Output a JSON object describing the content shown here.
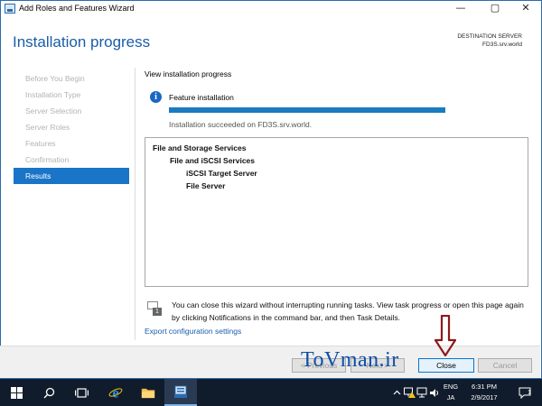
{
  "window": {
    "title": "Add Roles and Features Wizard",
    "controls": {
      "minimize": "—",
      "maximize": "▢",
      "close": "✕"
    }
  },
  "header": {
    "title": "Installation progress",
    "destination_label": "DESTINATION SERVER",
    "destination_server": "FD3S.srv.world"
  },
  "nav": {
    "items": [
      {
        "label": "Before You Begin"
      },
      {
        "label": "Installation Type"
      },
      {
        "label": "Server Selection"
      },
      {
        "label": "Server Roles"
      },
      {
        "label": "Features"
      },
      {
        "label": "Confirmation"
      },
      {
        "label": "Results"
      }
    ],
    "active_index": 6
  },
  "main": {
    "section_label": "View installation progress",
    "feature_label": "Feature installation",
    "progress_fraction": 1.0,
    "success_text": "Installation succeeded on FD3S.srv.world.",
    "results": [
      {
        "label": "File and Storage Services",
        "level": 0
      },
      {
        "label": "File and iSCSI Services",
        "level": 1
      },
      {
        "label": "iSCSI Target Server",
        "level": 2
      },
      {
        "label": "File Server",
        "level": 2
      }
    ],
    "note_badge": "1",
    "note_text": "You can close this wizard without interrupting running tasks. View task progress or open this page again by clicking Notifications in the command bar, and then Task Details.",
    "export_link": "Export configuration settings"
  },
  "footer": {
    "previous_label": "< Previous",
    "next_label": "Next >",
    "close_label": "Close",
    "cancel_label": "Cancel"
  },
  "watermark": "ToVman.ir",
  "taskbar": {
    "language_top": "ENG",
    "language_bottom": "JA",
    "time": "6:31 PM",
    "date": "2/9/2017",
    "notification_count": "1"
  },
  "colors": {
    "accent": "#1a74c7",
    "header_blue": "#1a5da8",
    "progress": "#1a7bbf",
    "taskbar": "#101c2b",
    "arrow": "#8b1a1a"
  }
}
